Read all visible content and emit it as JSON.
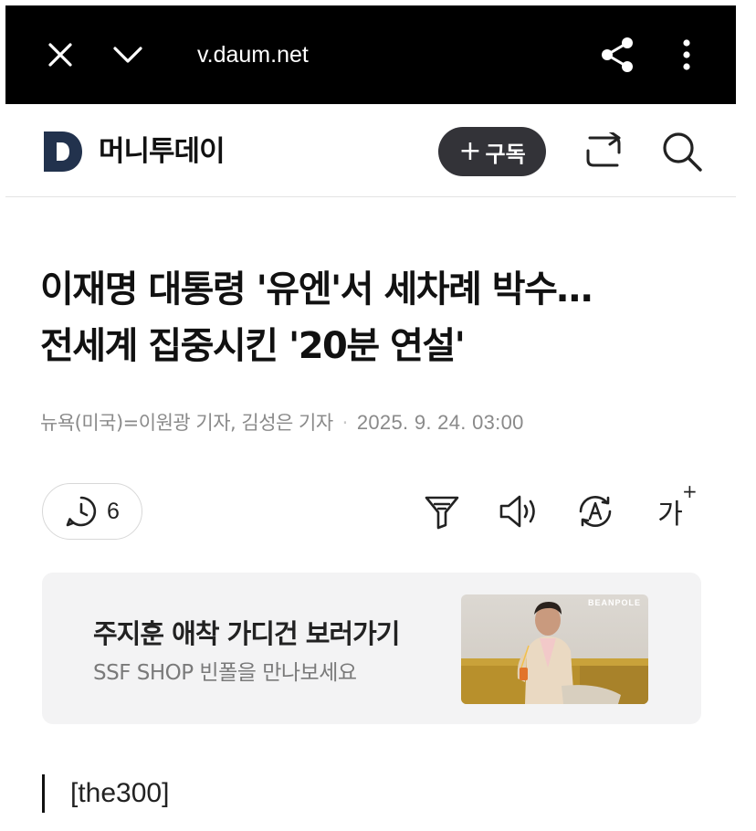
{
  "browser": {
    "url": "v.daum.net",
    "icons": [
      "close-icon",
      "chevron-down-icon",
      "share-icon",
      "more-vertical-icon"
    ]
  },
  "header": {
    "logo_letter": "D",
    "site_name": "머니투데이",
    "subscribe_plus": "+",
    "subscribe_label": "구독",
    "icons": [
      "share-arrow-icon",
      "search-icon"
    ],
    "colors": {
      "logo": "#22324d",
      "subscribe_bg": "#333338"
    }
  },
  "article": {
    "headline_line1": "이재명 대통령 '유엔'서 세차례 박수…",
    "headline_line2": "전세계 집중시킨 '20분 연설'",
    "byline": "뉴욕(미국)=이원광 기자, 김성은 기자",
    "date": "2025. 9. 24. 03:00",
    "comment_count": "6",
    "tools": [
      "summary-filter-icon",
      "speaker-icon",
      "translate-icon",
      "font-size-icon"
    ],
    "font_size_label": "가",
    "font_size_sup": "+",
    "section_tag": "[the300]"
  },
  "ad": {
    "title": "주지훈 애착 가디건 보러가기",
    "subtitle": "SSF SHOP 빈폴을 만나보세요",
    "brand": "BEANPOLE"
  }
}
